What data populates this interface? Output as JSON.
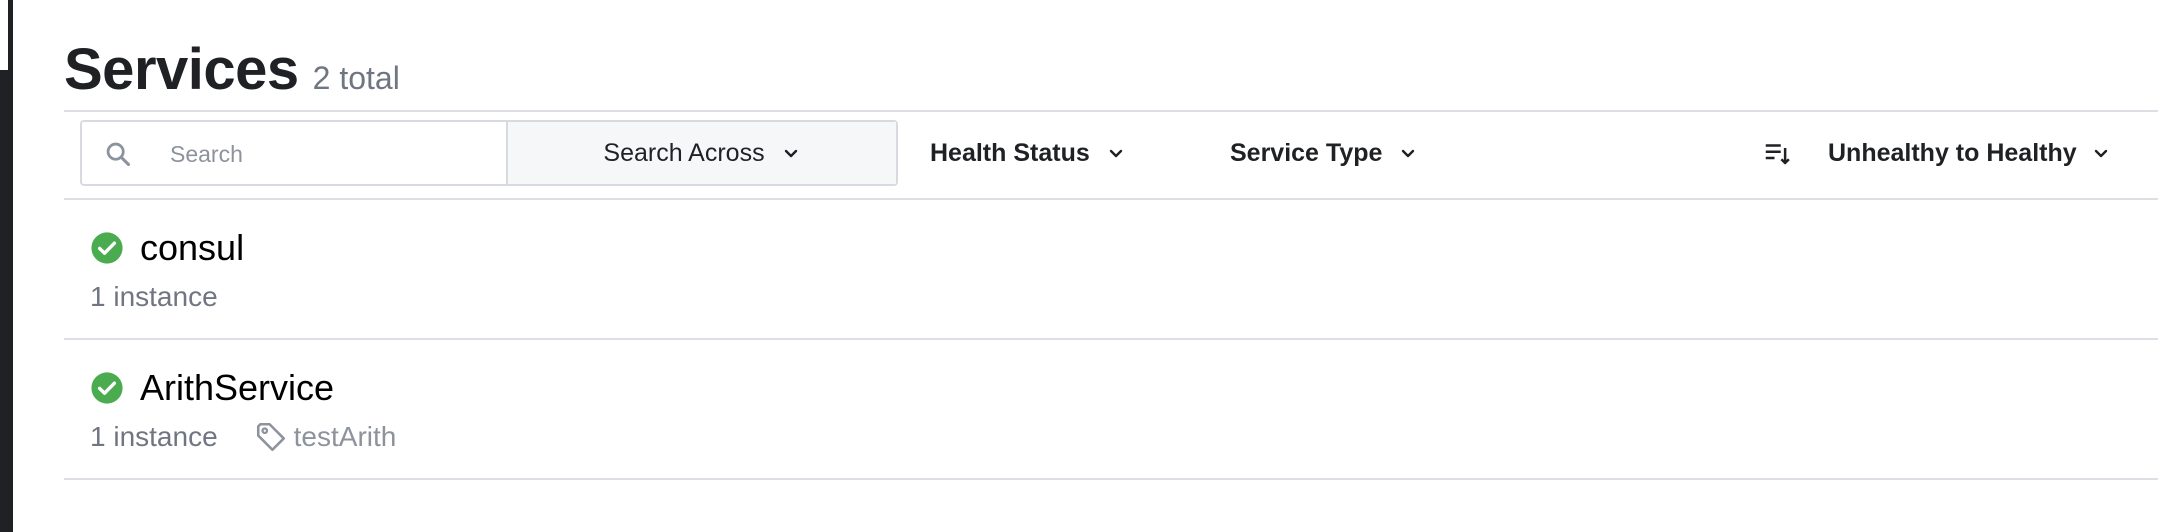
{
  "header": {
    "title": "Services",
    "total": "2 total"
  },
  "toolbar": {
    "search_placeholder": "Search",
    "search_value": "",
    "search_across_label": "Search Across",
    "health_status_label": "Health Status",
    "service_type_label": "Service Type",
    "sort_label": "Unhealthy to Healthy"
  },
  "services": [
    {
      "name": "consul",
      "status": "healthy",
      "instances": "1 instance",
      "tags": []
    },
    {
      "name": "ArithService",
      "status": "healthy",
      "instances": "1 instance",
      "tags": [
        "testArith"
      ]
    }
  ],
  "icons": {
    "search": "search-icon",
    "chevron": "chevron-down-icon",
    "sort": "sort-icon",
    "healthy": "check-circle-icon",
    "tag": "tag-icon"
  },
  "colors": {
    "healthy": "#4bab4f",
    "title": "#1f2124",
    "muted": "#6f7682",
    "border": "#dcdfe3"
  }
}
